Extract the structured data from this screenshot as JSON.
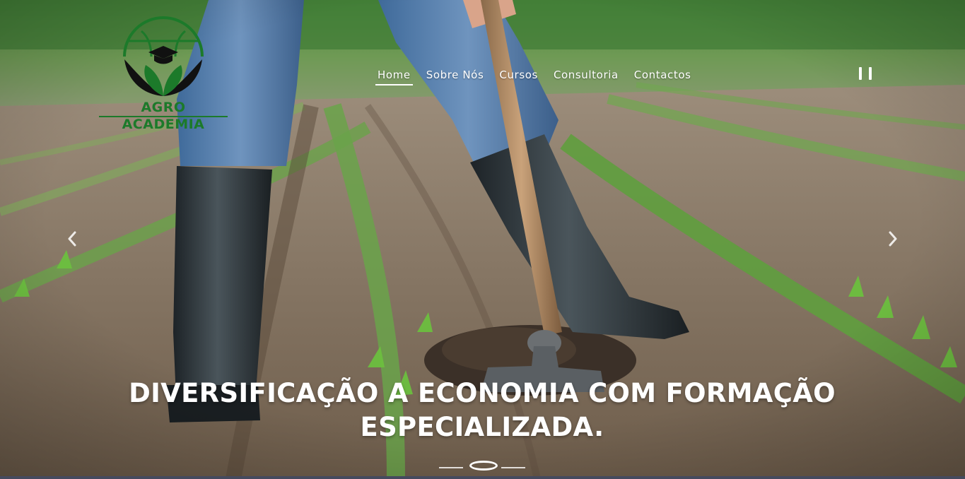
{
  "brand": {
    "name": "AGRO ACADEMIA",
    "logo_icon": "graduation-cap-leaf-globe-icon",
    "color": "#1c7a2a"
  },
  "nav": {
    "items": [
      {
        "label": "Home",
        "active": true
      },
      {
        "label": "Sobre Nós",
        "active": false
      },
      {
        "label": "Cursos",
        "active": false
      },
      {
        "label": "Consultoria",
        "active": false
      },
      {
        "label": "Contactos",
        "active": false
      }
    ]
  },
  "carousel": {
    "pause_icon": "pause-icon",
    "prev_icon": "chevron-left-icon",
    "next_icon": "chevron-right-icon",
    "caption": "DIVERSIFICAÇÃO A ECONOMIA COM FORMAÇÃO ESPECIALIZADA.",
    "slide_count": 3,
    "active_slide": 2
  }
}
